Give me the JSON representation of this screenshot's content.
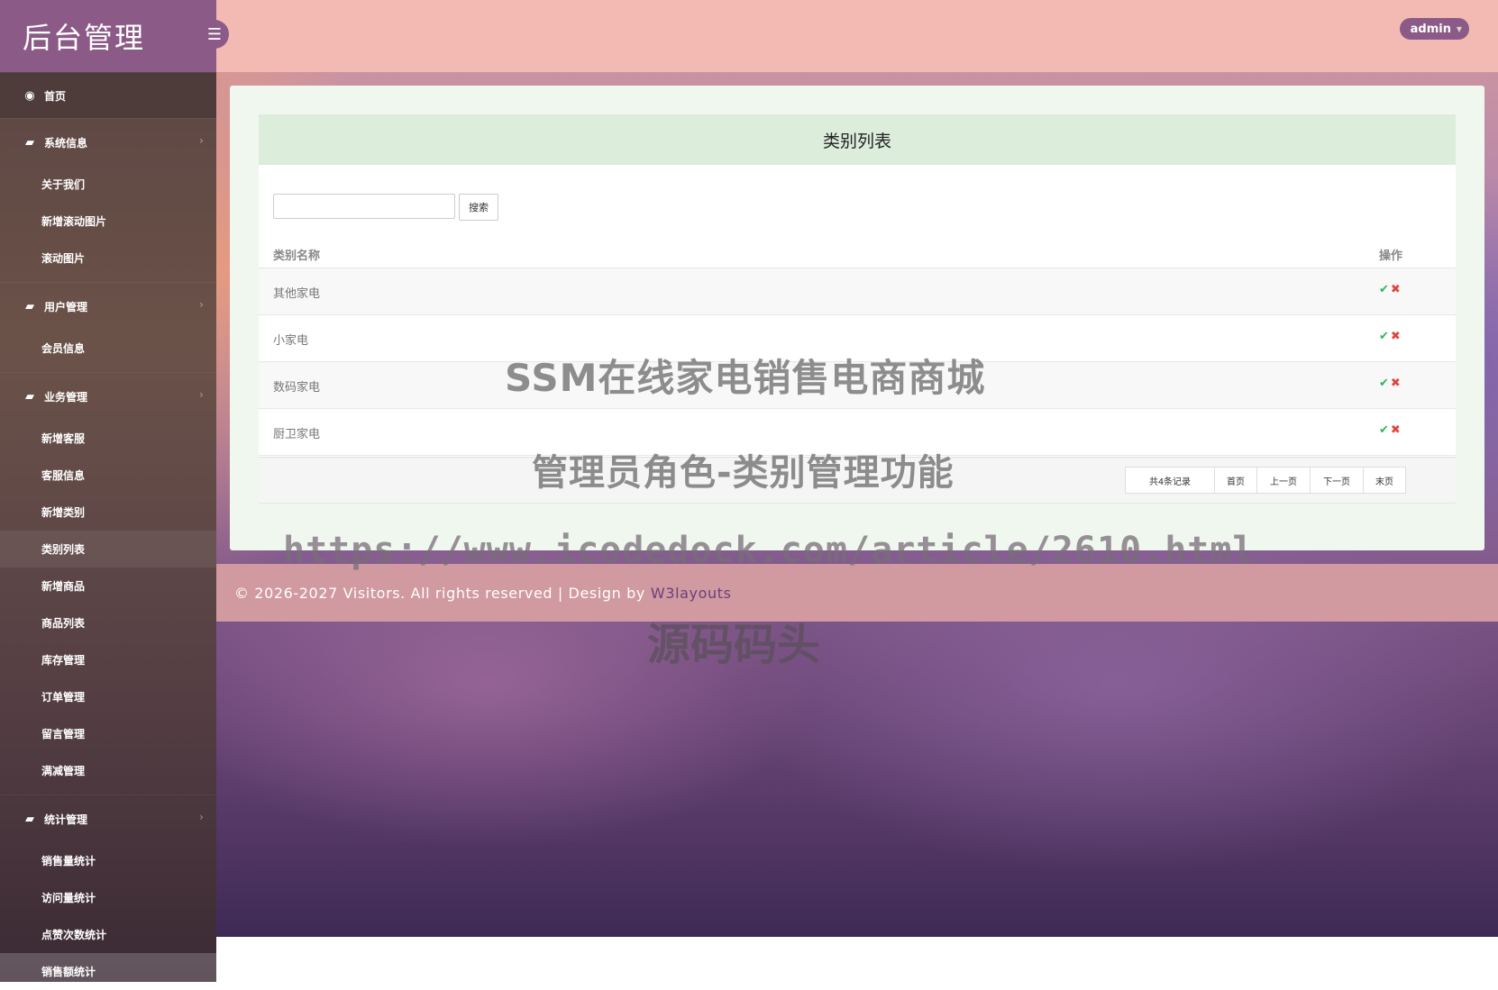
{
  "brand": {
    "title": "后台管理",
    "toggle_icon": "☰"
  },
  "header": {
    "user_label": "admin"
  },
  "sidebar": {
    "home": {
      "label": "首页",
      "icon": "dashboard-icon"
    },
    "sections": [
      {
        "label": "系统信息",
        "items": [
          "关于我们",
          "新增滚动图片",
          "滚动图片"
        ]
      },
      {
        "label": "用户管理",
        "items": [
          "会员信息"
        ]
      },
      {
        "label": "业务管理",
        "items": [
          "新增客服",
          "客服信息",
          "新增类别",
          "类别列表",
          "新增商品",
          "商品列表",
          "库存管理",
          "订单管理",
          "留言管理",
          "满减管理"
        ]
      },
      {
        "label": "统计管理",
        "items": [
          "销售量统计",
          "访问量统计",
          "点赞次数统计",
          "销售额统计"
        ]
      }
    ]
  },
  "main": {
    "panel_title": "类别列表",
    "search": {
      "value": "",
      "button_label": "搜索"
    },
    "columns": {
      "name": "类别名称",
      "ops": "操作"
    },
    "rows": [
      "其他家电",
      "小家电",
      "数码家电",
      "厨卫家电"
    ],
    "ops_icons": {
      "edit": "✔",
      "delete": "✖"
    },
    "pager": {
      "total": "共4条记录",
      "first": "首页",
      "prev": "上一页",
      "next": "下一页",
      "last": "末页"
    }
  },
  "footer": {
    "text": "© 2026-2027 Visitors. All rights reserved | Design by",
    "link": "W3layouts"
  },
  "watermark": {
    "line1": "SSM在线家电销售电商商城",
    "line2": "管理员角色-类别管理功能",
    "line3": "https://www.icodedock.com/article/2610.html",
    "line4": "源码码头"
  },
  "colors": {
    "accent": "#8b5a86",
    "header": "#f2bab3",
    "panel_title_bg": "#dceddc",
    "ok": "#31b55a",
    "delete": "#e0453d"
  }
}
